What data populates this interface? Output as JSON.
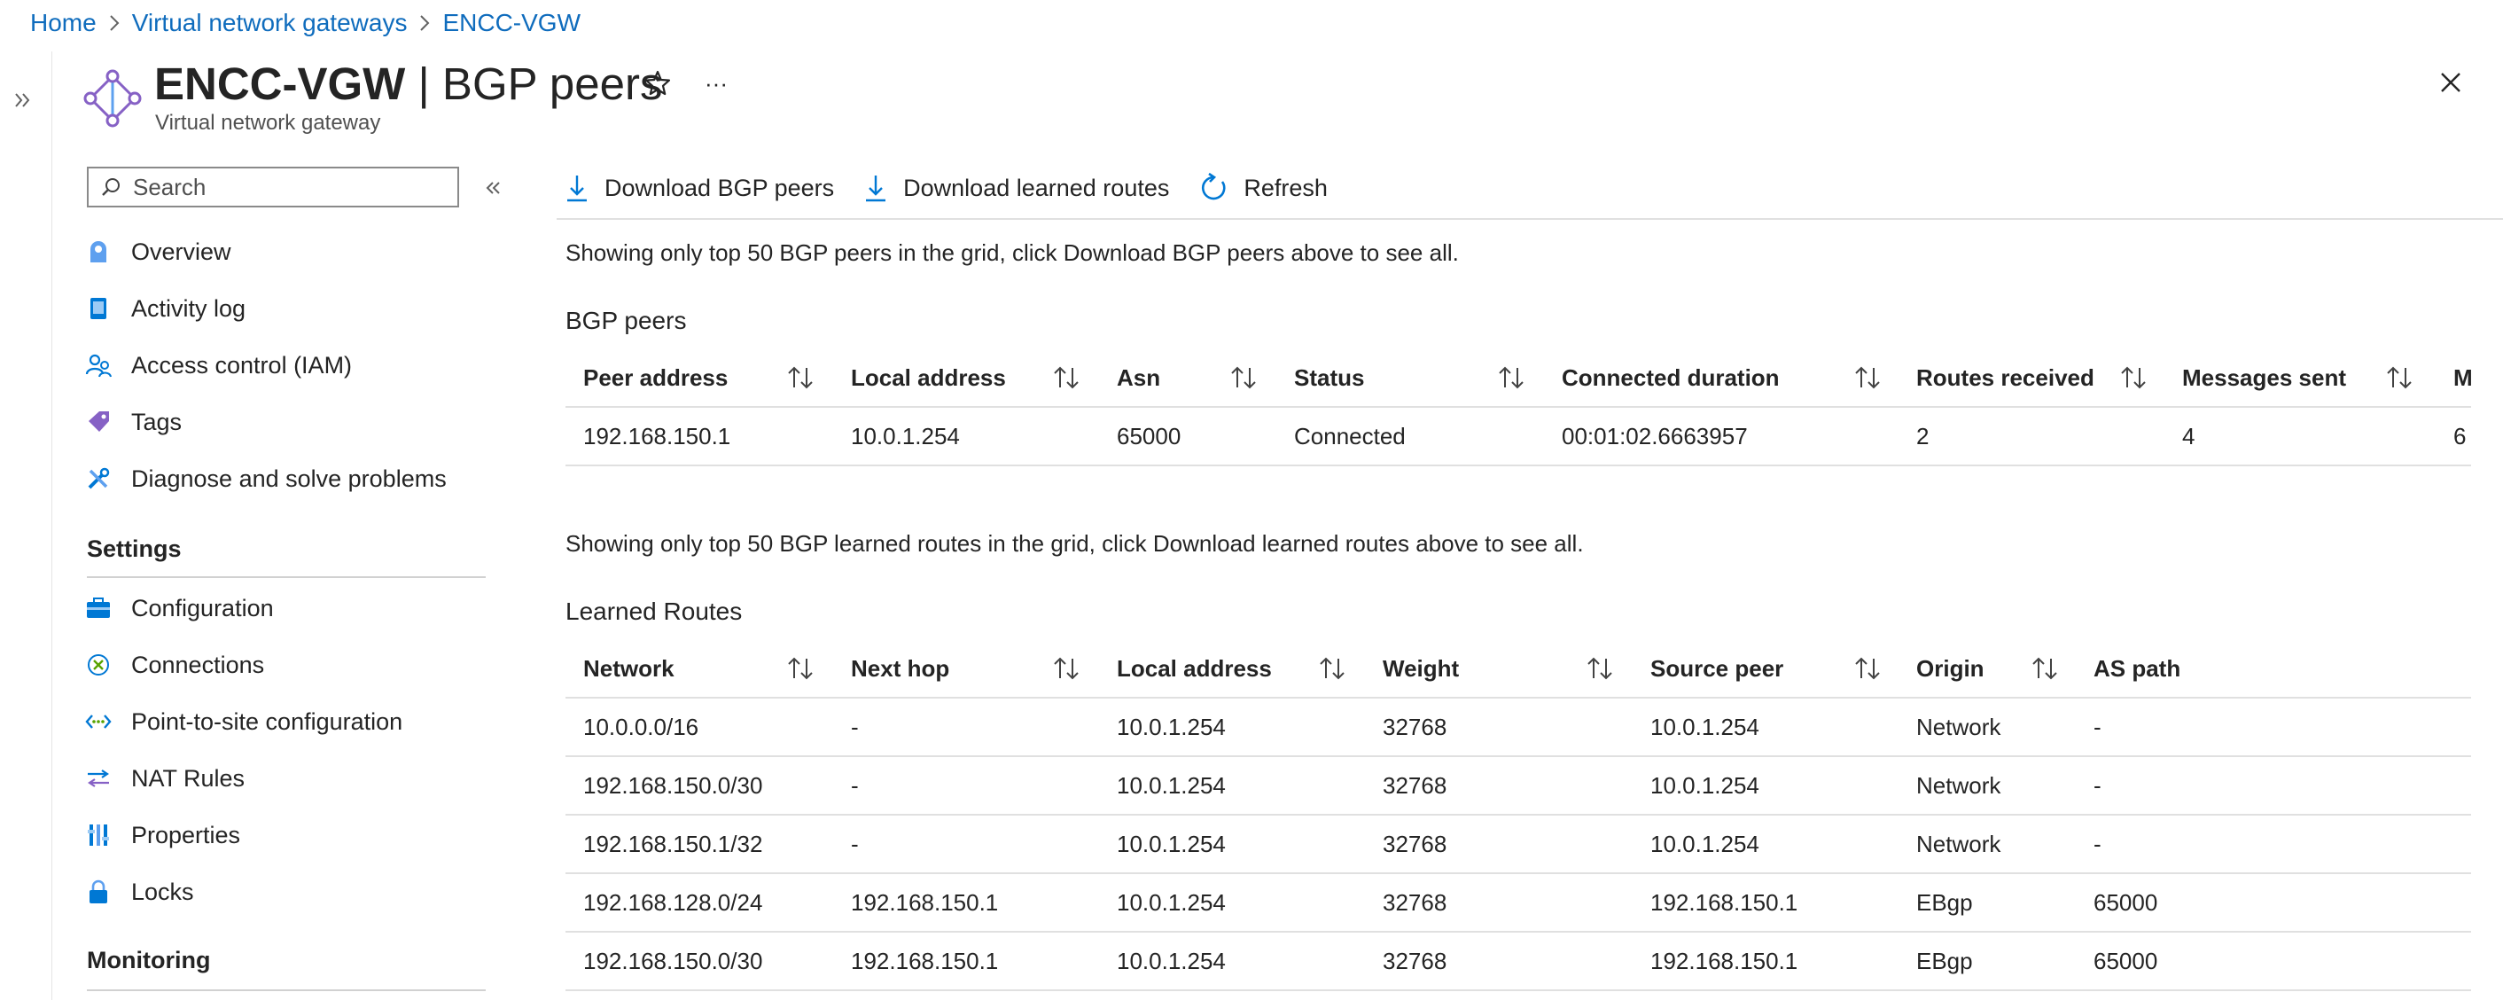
{
  "breadcrumb": [
    "Home",
    "Virtual network gateways",
    "ENCC-VGW"
  ],
  "header": {
    "title_name": "ENCC-VGW",
    "title_sep": " | ",
    "title_page": "BGP peers",
    "subtitle": "Virtual network gateway",
    "more": "···"
  },
  "search": {
    "placeholder": "Search"
  },
  "nav": {
    "items_top": [
      {
        "label": "Overview",
        "icon": "overview-icon"
      },
      {
        "label": "Activity log",
        "icon": "activity-log-icon"
      },
      {
        "label": "Access control (IAM)",
        "icon": "iam-icon"
      },
      {
        "label": "Tags",
        "icon": "tag-icon"
      },
      {
        "label": "Diagnose and solve problems",
        "icon": "wrench-icon"
      }
    ],
    "settings_heading": "Settings",
    "items_settings": [
      {
        "label": "Configuration",
        "icon": "briefcase-icon"
      },
      {
        "label": "Connections",
        "icon": "connections-icon"
      },
      {
        "label": "Point-to-site configuration",
        "icon": "p2s-icon"
      },
      {
        "label": "NAT Rules",
        "icon": "nat-icon"
      },
      {
        "label": "Properties",
        "icon": "properties-icon"
      },
      {
        "label": "Locks",
        "icon": "lock-icon"
      }
    ],
    "monitoring_heading": "Monitoring"
  },
  "toolbar": {
    "download_peers": "Download BGP peers",
    "download_routes": "Download learned routes",
    "refresh": "Refresh"
  },
  "peers_info": "Showing only top 50 BGP peers in the grid, click Download BGP peers above to see all.",
  "peers_title": "BGP peers",
  "peers": {
    "columns": [
      "Peer address",
      "Local address",
      "Asn",
      "Status",
      "Connected duration",
      "Routes received",
      "Messages sent",
      "Me"
    ],
    "rows": [
      [
        "192.168.150.1",
        "10.0.1.254",
        "65000",
        "Connected",
        "00:01:02.6663957",
        "2",
        "4",
        "6"
      ]
    ]
  },
  "routes_info": "Showing only top 50 BGP learned routes in the grid, click Download learned routes above to see all.",
  "routes_title": "Learned Routes",
  "routes": {
    "columns": [
      "Network",
      "Next hop",
      "Local address",
      "Weight",
      "Source peer",
      "Origin",
      "AS path"
    ],
    "rows": [
      [
        "10.0.0.0/16",
        "-",
        "10.0.1.254",
        "32768",
        "10.0.1.254",
        "Network",
        "-"
      ],
      [
        "192.168.150.0/30",
        "-",
        "10.0.1.254",
        "32768",
        "10.0.1.254",
        "Network",
        "-"
      ],
      [
        "192.168.150.1/32",
        "-",
        "10.0.1.254",
        "32768",
        "10.0.1.254",
        "Network",
        "-"
      ],
      [
        "192.168.128.0/24",
        "192.168.150.1",
        "10.0.1.254",
        "32768",
        "192.168.150.1",
        "EBgp",
        "65000"
      ],
      [
        "192.168.150.0/30",
        "192.168.150.1",
        "10.0.1.254",
        "32768",
        "192.168.150.1",
        "EBgp",
        "65000"
      ]
    ]
  },
  "colors": {
    "link": "#0f6cbd",
    "accent": "#0078d4",
    "border": "#e0e0e0"
  }
}
